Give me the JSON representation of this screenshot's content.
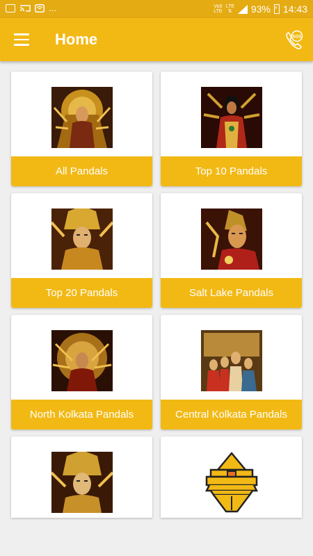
{
  "status_bar": {
    "dots": "...",
    "network_top": "Vo0",
    "network_bottom": "LTE",
    "lte": "LTE",
    "battery": "93%",
    "time": "14:43",
    "icons": [
      "gallery-icon",
      "cast-icon",
      "wifi-icon",
      "signal-icon",
      "battery-charging-icon"
    ]
  },
  "app_bar": {
    "title": "Home",
    "menu_icon": "hamburger-menu-icon",
    "sos_icon": "sos-phone-icon",
    "sos_text": "SOS"
  },
  "colors": {
    "status_bar": "#e5ab13",
    "app_bar": "#f2b915",
    "card_label": "#f2b915",
    "background": "#efefef"
  },
  "cards": [
    {
      "label": "All Pandals",
      "image": "durga-idol-image"
    },
    {
      "label": "Top 10 Pandals",
      "image": "durga-idol-image"
    },
    {
      "label": "Top 20 Pandals",
      "image": "durga-idol-image"
    },
    {
      "label": "Salt Lake Pandals",
      "image": "durga-idol-image"
    },
    {
      "label": "North Kolkata Pandals",
      "image": "durga-idol-image"
    },
    {
      "label": "Central Kolkata Pandals",
      "image": "durga-idol-image"
    },
    {
      "label": "",
      "image": "durga-idol-image"
    },
    {
      "label": "",
      "image": "pandal-building-icon"
    }
  ]
}
